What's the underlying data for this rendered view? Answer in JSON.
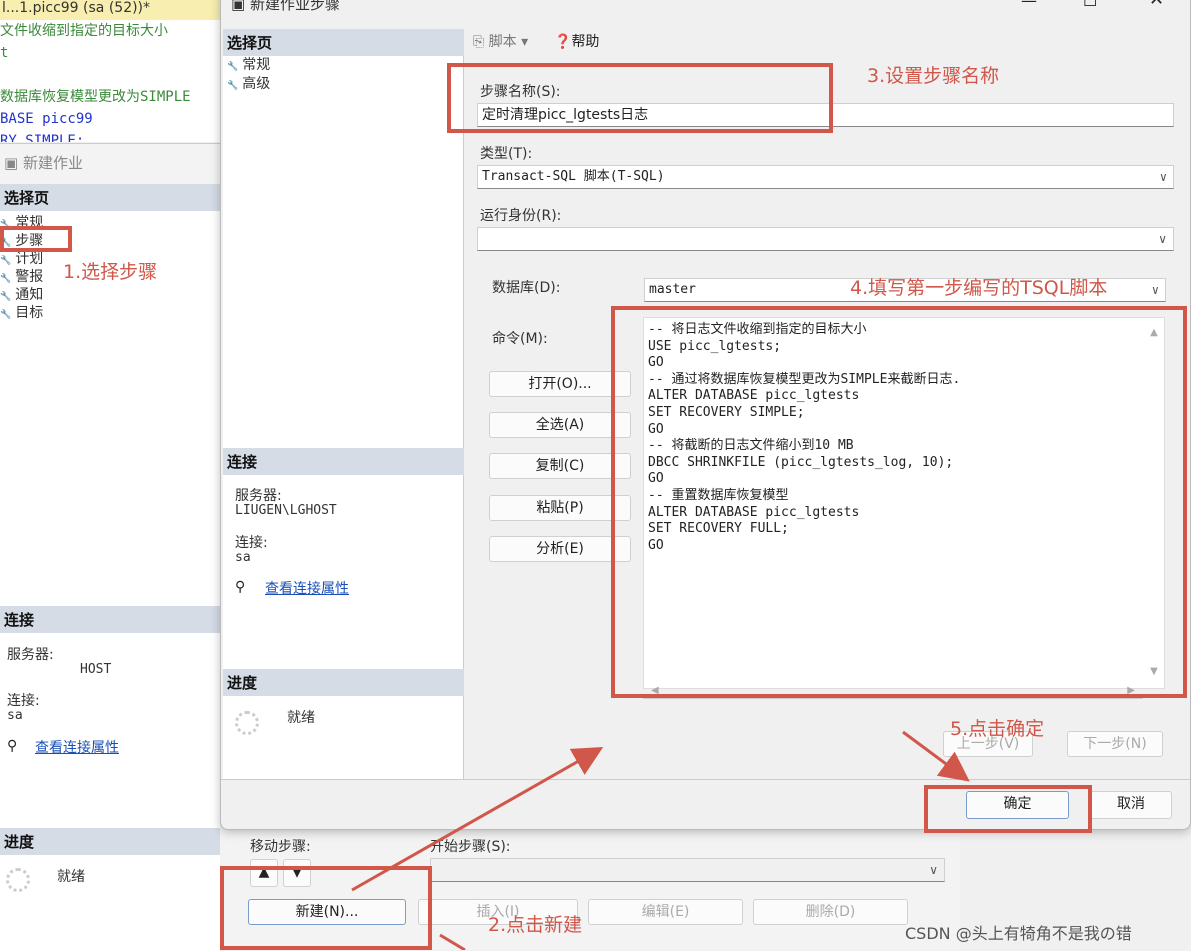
{
  "editor": {
    "tab_title": "l...1.picc99 (sa (52))*",
    "lines": [
      "文件收缩到指定的目标大小",
      "t",
      "",
      "数据库恢复模型更改为SIMPLE",
      "BASE picc99",
      "RY SIMPLE;"
    ]
  },
  "bg_job": {
    "title": "新建作业",
    "select_page": "选择页",
    "pages": [
      "常规",
      "步骤",
      "计划",
      "警报",
      "通知",
      "目标"
    ],
    "connection_header": "连接",
    "server_label": "服务器:",
    "server_value": "HOST",
    "conn_label": "连接:",
    "conn_value": "sa",
    "view_link": "查看连接属性",
    "progress_header": "进度",
    "progress_status": "就绪",
    "move_step": "移动步骤:",
    "start_step": "开始步骤(S):",
    "buttons": [
      "新建(N)...",
      "插入(I)",
      "编辑(E)",
      "删除(D)"
    ]
  },
  "dialog": {
    "title": "新建作业步骤",
    "select_page": "选择页",
    "pages": [
      "常规",
      "高级"
    ],
    "connection_header": "连接",
    "server_label": "服务器:",
    "server_value": "LIUGEN\\LGHOST",
    "conn_label": "连接:",
    "conn_value": "sa",
    "view_link": "查看连接属性",
    "progress_header": "进度",
    "progress_status": "就绪",
    "toolbar": {
      "script": "脚本",
      "help": "帮助"
    },
    "step_name_label": "步骤名称(S):",
    "step_name_value": "定时清理picc_lgtests日志",
    "type_label": "类型(T):",
    "type_value": "Transact-SQL 脚本(T-SQL)",
    "run_as_label": "运行身份(R):",
    "run_as_value": "",
    "database_label": "数据库(D):",
    "database_value": "master",
    "command_label": "命令(M):",
    "command_buttons": [
      "打开(O)...",
      "全选(A)",
      "复制(C)",
      "粘贴(P)",
      "分析(E)"
    ],
    "command_lines": [
      "-- 将日志文件收缩到指定的目标大小",
      "USE picc_lgtests;",
      "GO",
      "-- 通过将数据库恢复模型更改为SIMPLE来截断日志.",
      "ALTER DATABASE picc_lgtests",
      "SET RECOVERY SIMPLE;",
      "GO",
      "-- 将截断的日志文件缩小到10 MB",
      "DBCC SHRINKFILE (picc_lgtests_log, 10);",
      "GO",
      "-- 重置数据库恢复模型",
      "ALTER DATABASE picc_lgtests",
      "SET RECOVERY FULL;",
      "GO"
    ],
    "prev": "上一步(V)",
    "next": "下一步(N)",
    "ok": "确定",
    "cancel": "取消"
  },
  "annotations": [
    "1.选择步骤",
    "2.点击新建",
    "3.设置步骤名称",
    "4.填写第一步编写的TSQL脚本",
    "5.点击确定"
  ],
  "watermark": "CSDN @头上有犄角不是我の错",
  "colors": {
    "annotation": "#d0574a",
    "header": "#d5dce6",
    "link": "#1a4fb8"
  }
}
